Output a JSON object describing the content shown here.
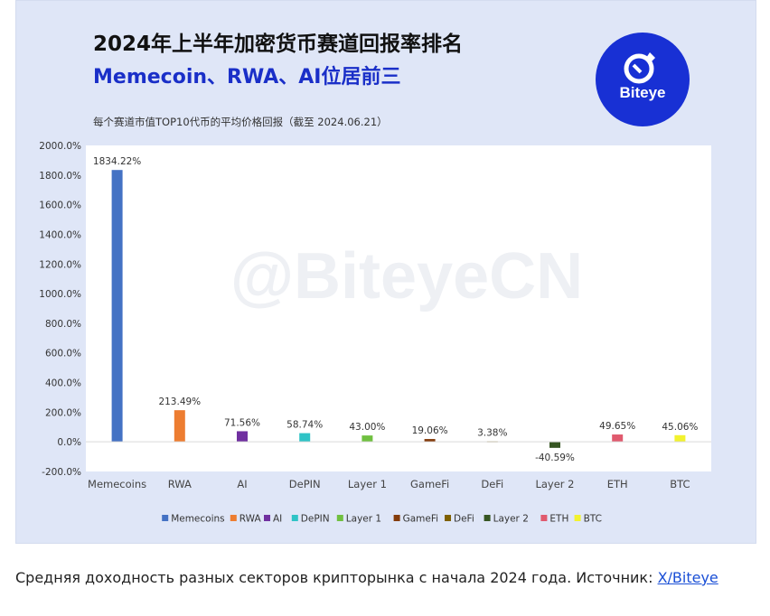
{
  "header": {
    "title": "2024年上半年加密货币赛道回报率排名",
    "subtitle": "Memecoin、RWA、AI位居前三",
    "note": "每个赛道市值TOP10代币的平均价格回报（截至 2024.06.21）",
    "logo_text": "Biteye",
    "watermark": "@BiteyeCN"
  },
  "caption": {
    "text": "Средняя доходность разных секторов крипторынка с начала 2024 года. Источник: ",
    "link": "X/Biteye"
  },
  "chart_data": {
    "type": "bar",
    "categories": [
      "Memecoins",
      "RWA",
      "AI",
      "DePIN",
      "Layer 1",
      "GameFi",
      "DeFi",
      "Layer 2",
      "ETH",
      "BTC"
    ],
    "values": [
      1834.22,
      213.49,
      71.56,
      58.74,
      43.0,
      19.06,
      3.38,
      -40.59,
      49.65,
      45.06
    ],
    "value_labels": [
      "1834.22%",
      "213.49%",
      "71.56%",
      "58.74%",
      "43.00%",
      "19.06%",
      "3.38%",
      "-40.59%",
      "49.65%",
      "45.06%"
    ],
    "colors": [
      "#4472c4",
      "#ed7d31",
      "#7030a0",
      "#2fc3c6",
      "#70c040",
      "#843c0c",
      "#7f6000",
      "#375623",
      "#e05a6e",
      "#f2f22e"
    ],
    "ylim": [
      -200,
      2000
    ],
    "yticks": [
      "-200.0%",
      "0.0%",
      "200.0%",
      "400.0%",
      "600.0%",
      "800.0%",
      "1000.0%",
      "1200.0%",
      "1400.0%",
      "1600.0%",
      "1800.0%",
      "2000.0%"
    ],
    "ytick_values": [
      -200,
      0,
      200,
      400,
      600,
      800,
      1000,
      1200,
      1400,
      1600,
      1800,
      2000
    ],
    "legend_position": "bottom",
    "grid": false
  }
}
